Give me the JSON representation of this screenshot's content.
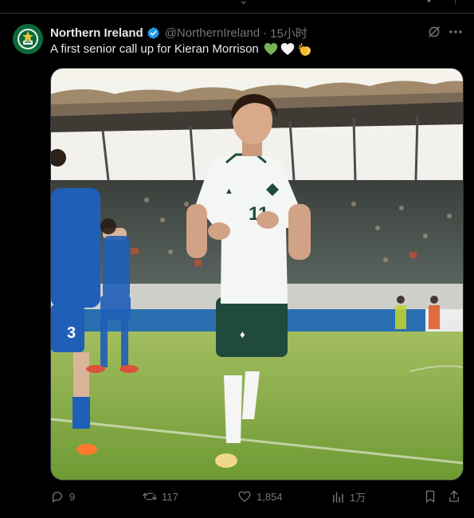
{
  "post": {
    "author": {
      "display_name": "Northern Ireland",
      "handle": "@NorthernIreland",
      "verified": true
    },
    "timestamp": "15小时",
    "separator": "·",
    "text": "A first senior call up for Kieran Morrison",
    "emojis": [
      "green-heart-icon",
      "white-heart-icon",
      "clapping-hands-icon"
    ],
    "photo": {
      "kit_colors": {
        "home_shirt": "#f4f6f4",
        "home_shorts": "#1f4a3c",
        "away_kit": "#1f5fb8"
      },
      "shirt_number": "11",
      "opponent_number": "3"
    },
    "actions": {
      "replies": "9",
      "reposts": "117",
      "likes": "1,854",
      "views": "1万"
    }
  },
  "colors": {
    "background": "#000000",
    "text": "#e7e9ea",
    "muted": "#71767b",
    "verified": "#1d9bf0",
    "border": "#2f3336"
  }
}
